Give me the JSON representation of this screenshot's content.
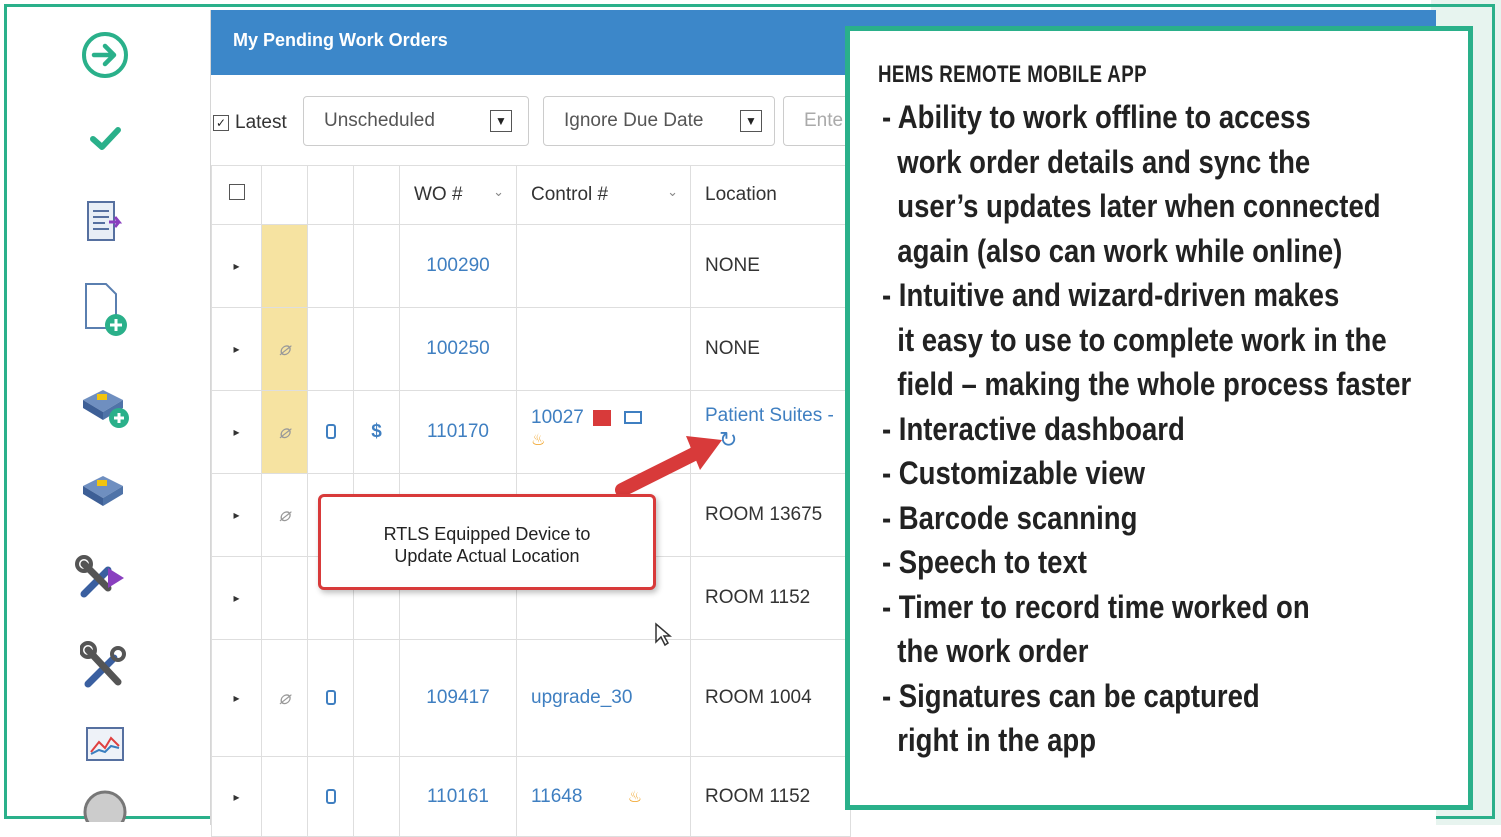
{
  "panel": {
    "title": "My Pending Work Orders",
    "filters": {
      "latest_label": "Latest",
      "status_value": "Unscheduled",
      "due_value": "Ignore Due Date",
      "search_placeholder": "Ente"
    },
    "columns": {
      "wo": "WO #",
      "control": "Control #",
      "location": "Location"
    },
    "rows": [
      {
        "wo": "100290",
        "control": "",
        "location": "NONE"
      },
      {
        "wo": "100250",
        "control": "",
        "location": "NONE"
      },
      {
        "wo": "110170",
        "control": "10027",
        "location": "Patient Suites -",
        "dollar": "$"
      },
      {
        "wo": "",
        "control": "",
        "location": "ROOM 13675"
      },
      {
        "wo": "",
        "control": "",
        "location": "ROOM 1152"
      },
      {
        "wo": "109417",
        "control": "upgrade_30",
        "location": "ROOM 1004"
      },
      {
        "wo": "110161",
        "control": "11648",
        "location": "ROOM 1152"
      }
    ]
  },
  "callout": {
    "line1": "RTLS Equipped Device to",
    "line2": "Update Actual Location"
  },
  "info": {
    "title": "HEMS REMOTE MOBILE APP",
    "features": [
      "- Ability to work offline to access",
      "  work order details and sync the",
      "  user’s updates later when connected",
      "  again (also can work while online)",
      "- Intuitive and wizard-driven makes",
      "  it easy to use to complete work in the",
      "  field – making the whole process faster",
      "- Interactive dashboard",
      "- Customizable view",
      "- Barcode scanning",
      "- Speech to text",
      "- Timer to record time worked on",
      "  the work order",
      "- Signatures can be captured",
      "  right in the app"
    ]
  },
  "colors": {
    "accent": "#2ab08a",
    "header_blue": "#3c87c9",
    "link": "#3f7fc1",
    "callout_red": "#d83a3a"
  },
  "sidebar_icons": [
    "arrow-right-circle-icon",
    "checkmark-icon",
    "document-export-icon",
    "new-document-icon",
    "add-device-icon",
    "device-icon",
    "tools-arrow-icon",
    "tools-icon",
    "chart-icon",
    "badge-icon"
  ]
}
